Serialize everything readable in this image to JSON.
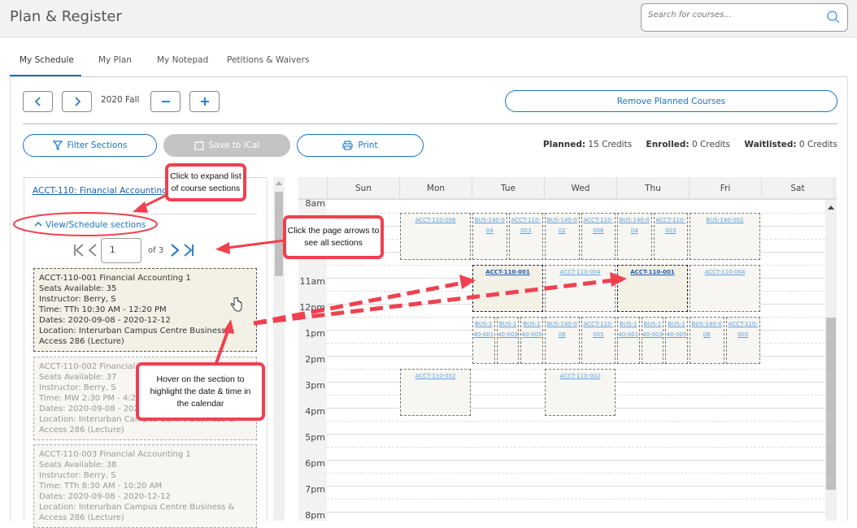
{
  "header": {
    "title": "Plan & Register",
    "search_placeholder": "Search for courses..."
  },
  "tabs": [
    {
      "label": "My Schedule",
      "active": true
    },
    {
      "label": "My Plan"
    },
    {
      "label": "My Notepad"
    },
    {
      "label": "Petitions & Waivers"
    }
  ],
  "term": {
    "label": "2020 Fall",
    "prev_icon": "chevron-left",
    "next_icon": "chevron-right",
    "minus_icon": "minus",
    "plus_icon": "plus"
  },
  "toolbar": {
    "remove_planned": "Remove Planned Courses",
    "filter_sections": "Filter Sections",
    "save_ical": "Save to iCal",
    "print": "Print"
  },
  "credits": {
    "planned_label": "Planned:",
    "planned_value": "15 Credits",
    "enrolled_label": "Enrolled:",
    "enrolled_value": "0 Credits",
    "waitlisted_label": "Waitlisted:",
    "waitlisted_value": "0 Credits"
  },
  "course": {
    "title": "ACCT-110: Financial Accounting 1",
    "view_sections": "View/Schedule sections",
    "page_current": "1",
    "page_of": "of 3",
    "sections": [
      {
        "name": "ACCT-110-001 Financial Accounting 1",
        "seats": "Seats Available: 35",
        "instructor": "Instructor: Berry, S",
        "time": "Time: TTh 10:30 AM - 12:20 PM",
        "dates": "Dates: 2020-09-08 - 2020-12-12",
        "location": "Location: Interurban Campus Centre Business & Access 286 (Lecture)"
      },
      {
        "name": "ACCT-110-002 Financial Accounting 1",
        "seats": "Seats Available: 37",
        "instructor": "Instructor: Berry, S",
        "time": "Time: MW 2:30 PM - 4:20 PM",
        "dates": "Dates: 2020-09-08 - 2020-12-12",
        "location": "Location: Interurban Campus Centre Business & Access 286 (Lecture)"
      },
      {
        "name": "ACCT-110-003 Financial Accounting 1",
        "seats": "Seats Available: 38",
        "instructor": "Instructor: Berry, S",
        "time": "Time: TTh 8:30 AM - 10:20 AM",
        "dates": "Dates: 2020-09-08 - 2020-12-12",
        "location": "Location: Interurban Campus Centre Business & Access 286 (Lecture)"
      }
    ]
  },
  "calendar": {
    "days": [
      "Sun",
      "Mon",
      "Tue",
      "Wed",
      "Thu",
      "Fri",
      "Sat"
    ],
    "times": [
      "8am",
      "9am",
      "10am",
      "11am",
      "12pm",
      "1pm",
      "2pm",
      "3pm",
      "4pm",
      "5pm",
      "6pm",
      "7pm",
      "8pm"
    ],
    "events": [
      {
        "label": "ACCT-110-006",
        "day": 1,
        "start": 8.5,
        "end": 10.3,
        "col": 0,
        "cols": 1
      },
      {
        "label": "BUS-140-004",
        "day": 2,
        "start": 8.5,
        "end": 10.3,
        "col": 0,
        "cols": 2
      },
      {
        "label": "ACCT-110-003",
        "day": 2,
        "start": 8.5,
        "end": 10.3,
        "col": 1,
        "cols": 2
      },
      {
        "label": "BUS-140-002",
        "day": 3,
        "start": 8.5,
        "end": 10.3,
        "col": 0,
        "cols": 2
      },
      {
        "label": "ACCT-110-006",
        "day": 3,
        "start": 8.5,
        "end": 10.3,
        "col": 1,
        "cols": 2
      },
      {
        "label": "BUS-140-004",
        "day": 4,
        "start": 8.5,
        "end": 10.3,
        "col": 0,
        "cols": 2
      },
      {
        "label": "ACCT-110-003",
        "day": 4,
        "start": 8.5,
        "end": 10.3,
        "col": 1,
        "cols": 2
      },
      {
        "label": "BUS-140-002",
        "day": 5,
        "start": 8.5,
        "end": 10.3,
        "col": 0,
        "cols": 1
      },
      {
        "label": "ACCT-110-001",
        "day": 2,
        "start": 10.5,
        "end": 12.3,
        "col": 0,
        "cols": 1,
        "highlight": true
      },
      {
        "label": "ACCT-110-004",
        "day": 3,
        "start": 10.5,
        "end": 12.3,
        "col": 0,
        "cols": 1
      },
      {
        "label": "ACCT-110-001",
        "day": 4,
        "start": 10.5,
        "end": 12.3,
        "col": 0,
        "cols": 1,
        "highlight": true
      },
      {
        "label": "ACCT-110-004",
        "day": 5,
        "start": 10.5,
        "end": 12.3,
        "col": 0,
        "cols": 1
      },
      {
        "label": "BUS-140-001",
        "day": 2,
        "start": 12.5,
        "end": 14.3,
        "col": 0,
        "cols": 3
      },
      {
        "label": "BUS-140-003",
        "day": 2,
        "start": 12.5,
        "end": 14.3,
        "col": 1,
        "cols": 3
      },
      {
        "label": "BUS-140-005",
        "day": 2,
        "start": 12.5,
        "end": 14.3,
        "col": 2,
        "cols": 3
      },
      {
        "label": "BUS-140-006",
        "day": 3,
        "start": 12.5,
        "end": 14.3,
        "col": 0,
        "cols": 2
      },
      {
        "label": "ACCT-110-005",
        "day": 3,
        "start": 12.5,
        "end": 14.3,
        "col": 1,
        "cols": 2
      },
      {
        "label": "BUS-140-001",
        "day": 4,
        "start": 12.5,
        "end": 14.3,
        "col": 0,
        "cols": 3
      },
      {
        "label": "BUS-140-003",
        "day": 4,
        "start": 12.5,
        "end": 14.3,
        "col": 1,
        "cols": 3
      },
      {
        "label": "BUS-140-005",
        "day": 4,
        "start": 12.5,
        "end": 14.3,
        "col": 2,
        "cols": 3
      },
      {
        "label": "BUS-140-006",
        "day": 5,
        "start": 12.5,
        "end": 14.3,
        "col": 0,
        "cols": 2
      },
      {
        "label": "ACCT-110-005",
        "day": 5,
        "start": 12.5,
        "end": 14.3,
        "col": 1,
        "cols": 2
      },
      {
        "label": "ACCT-110-002",
        "day": 1,
        "start": 14.5,
        "end": 16.3,
        "col": 0,
        "cols": 1
      },
      {
        "label": "ACCT-110-002",
        "day": 3,
        "start": 14.5,
        "end": 16.3,
        "col": 0,
        "cols": 1
      }
    ]
  },
  "annotations": {
    "expand": "Click to expand list of course sections",
    "arrows": "Click the page arrows to see all sections",
    "hover": "Hover on the section to highlight the date & time in the calendar",
    "accent_color": "#f04050"
  }
}
